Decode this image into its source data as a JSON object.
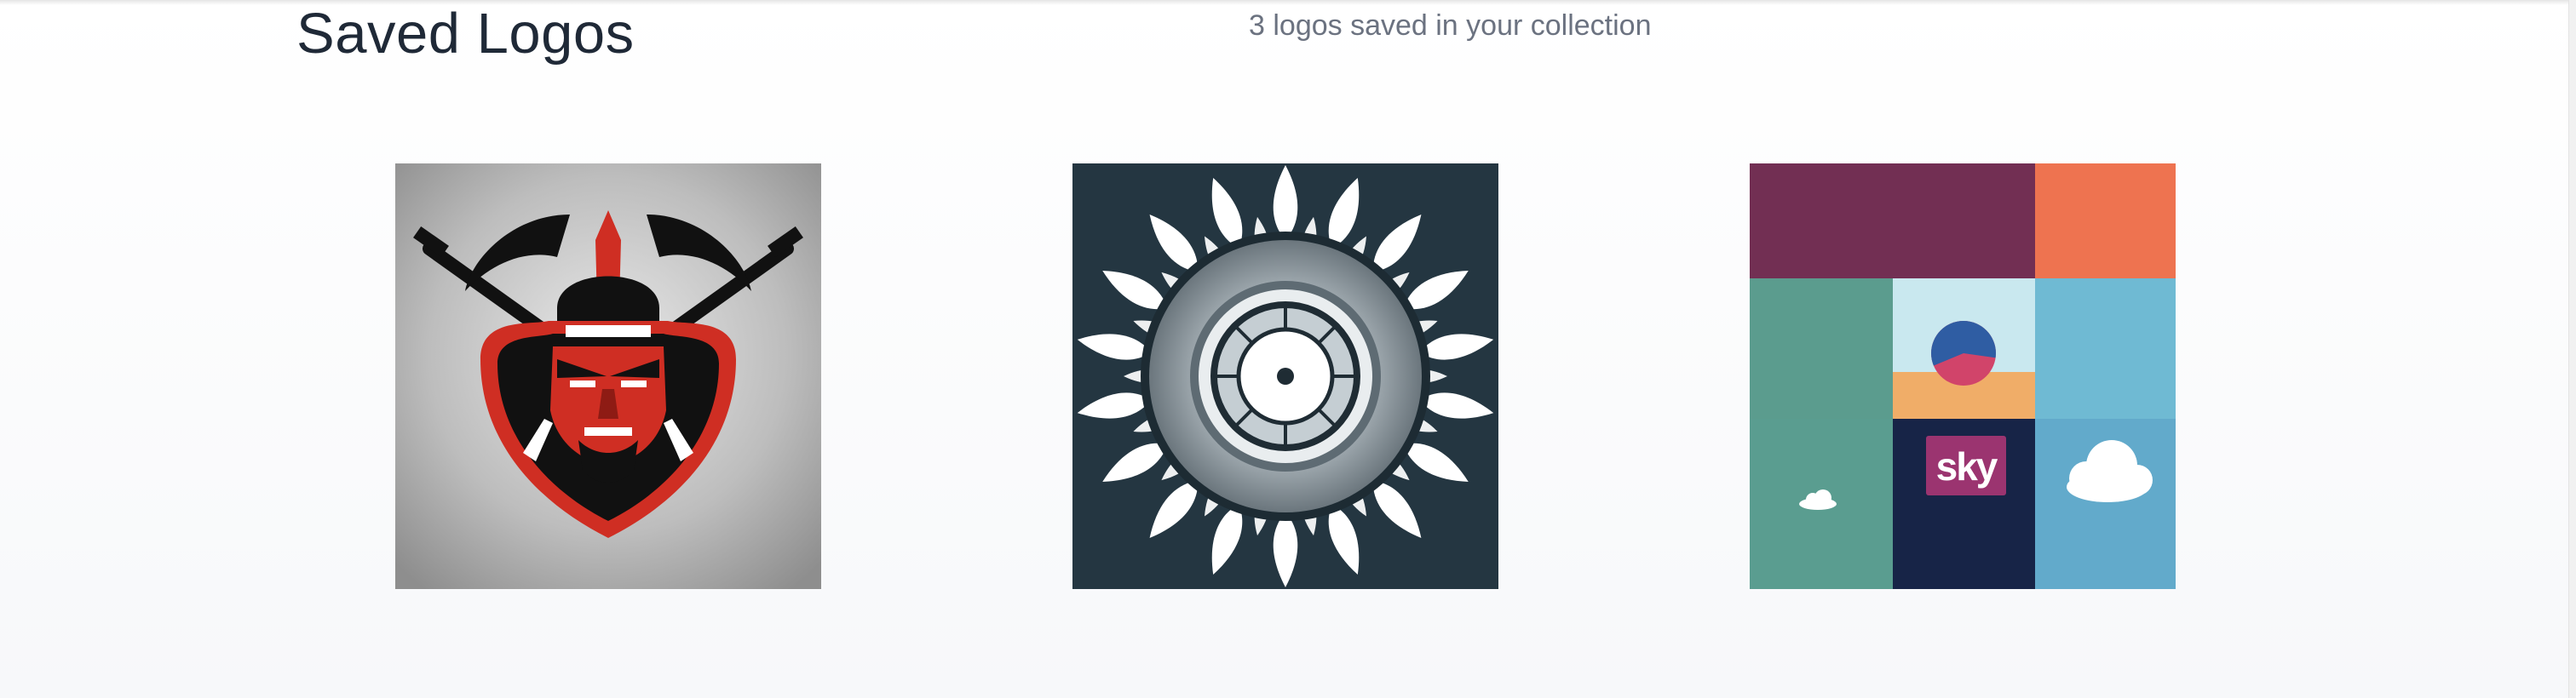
{
  "header": {
    "title": "Saved Logos",
    "subtitle": "3 logos saved in your collection"
  },
  "logos": [
    {
      "icon": "samurai-mask-logo-icon",
      "colors": [
        "#cf2e23",
        "#111111",
        "#c9c9c9"
      ]
    },
    {
      "icon": "sun-wheel-logo-icon",
      "colors": [
        "#243641",
        "#ffffff",
        "#9aa4aa"
      ]
    },
    {
      "icon": "sky-tiles-logo-icon",
      "colors": [
        "#722f53",
        "#ee7350",
        "#5b9c8e",
        "#6fbad3",
        "#172447"
      ],
      "text": "sky"
    }
  ]
}
